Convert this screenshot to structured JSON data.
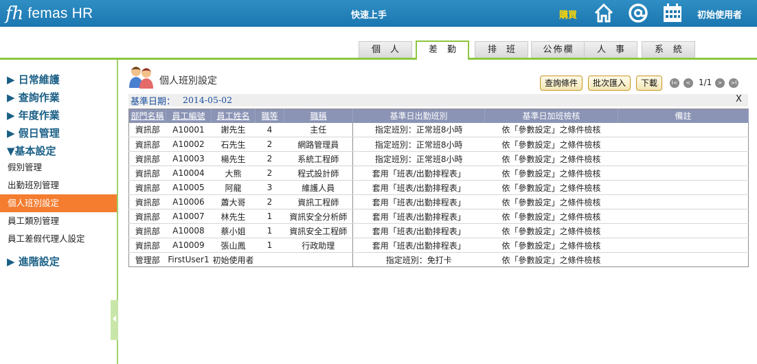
{
  "header": {
    "logo_mark": "fh",
    "logo_text": "femas HR",
    "quick_link": "快速上手",
    "buy_link": "購買",
    "user_name": "初始使用者",
    "icons": [
      "home-icon",
      "at-icon",
      "calendar-icon"
    ]
  },
  "tabs": [
    {
      "label": "個人",
      "active": false
    },
    {
      "label": "差勤",
      "active": true
    },
    {
      "label": "排班",
      "active": false
    },
    {
      "label": "公佈欄",
      "active": false
    },
    {
      "label": "人事",
      "active": false
    },
    {
      "label": "系統",
      "active": false
    }
  ],
  "sidebar": {
    "sections": [
      {
        "label": "▶ 日常維護"
      },
      {
        "label": "▶ 查詢作業"
      },
      {
        "label": "▶ 年度作業"
      },
      {
        "label": "▶ 假日管理"
      },
      {
        "label": "▼基本設定"
      },
      {
        "label": "▶ 進階設定"
      }
    ],
    "items": [
      {
        "label": "假別管理",
        "active": false
      },
      {
        "label": "出勤班別管理",
        "active": false
      },
      {
        "label": "個人班別設定",
        "active": true
      },
      {
        "label": "員工類別管理",
        "active": false
      },
      {
        "label": "員工差假代理人設定",
        "active": false
      }
    ]
  },
  "page": {
    "title": "個人班別設定",
    "buttons": {
      "query": "查詢條件",
      "batch_import": "批次匯入",
      "download": "下載"
    },
    "pager": {
      "first": "I<",
      "prev": "<",
      "text": "1/1",
      "next": ">",
      "last": ">I"
    },
    "date_label": "基準日期：",
    "date_value": "2014-05-02",
    "close": "X"
  },
  "table": {
    "columns": [
      "部門名稱",
      "員工編號",
      "員工姓名",
      "職等",
      "職稱",
      "基準日出勤班別",
      "基準日加班檢核",
      "備註"
    ],
    "rows": [
      {
        "dept": "資訊部",
        "id": "A10001",
        "name": "謝先生",
        "grade": "4",
        "title": "主任",
        "shift": "指定班別：正常班8小時",
        "shift_link": false,
        "overtime": "依「參數設定」之條件檢核",
        "note": ""
      },
      {
        "dept": "資訊部",
        "id": "A10002",
        "name": "石先生",
        "grade": "2",
        "title": "網路管理員",
        "shift": "指定班別：正常班8小時",
        "shift_link": false,
        "overtime": "依「參數設定」之條件檢核",
        "note": ""
      },
      {
        "dept": "資訊部",
        "id": "A10003",
        "name": "楊先生",
        "grade": "2",
        "title": "系統工程師",
        "shift": "指定班別：正常班8小時",
        "shift_link": false,
        "overtime": "依「參數設定」之條件檢核",
        "note": ""
      },
      {
        "dept": "資訊部",
        "id": "A10004",
        "name": "大熊",
        "grade": "2",
        "title": "程式設計師",
        "shift": "套用「班表/出勤排程表」",
        "shift_link": true,
        "overtime": "依「參數設定」之條件檢核",
        "note": ""
      },
      {
        "dept": "資訊部",
        "id": "A10005",
        "name": "阿龍",
        "grade": "3",
        "title": "維護人員",
        "shift": "套用「班表/出勤排程表」",
        "shift_link": true,
        "overtime": "依「參數設定」之條件檢核",
        "note": ""
      },
      {
        "dept": "資訊部",
        "id": "A10006",
        "name": "蕭大哥",
        "grade": "2",
        "title": "資訊工程師",
        "shift": "套用「班表/出勤排程表」",
        "shift_link": true,
        "overtime": "依「參數設定」之條件檢核",
        "note": ""
      },
      {
        "dept": "資訊部",
        "id": "A10007",
        "name": "林先生",
        "grade": "1",
        "title": "資訊安全分析師",
        "shift": "套用「班表/出勤排程表」",
        "shift_link": true,
        "overtime": "依「參數設定」之條件檢核",
        "note": ""
      },
      {
        "dept": "資訊部",
        "id": "A10008",
        "name": "蔡小姐",
        "grade": "1",
        "title": "資訊安全工程師",
        "shift": "套用「班表/出勤排程表」",
        "shift_link": true,
        "overtime": "依「參數設定」之條件檢核",
        "note": ""
      },
      {
        "dept": "資訊部",
        "id": "A10009",
        "name": "張山鳳",
        "grade": "1",
        "title": "行政助理",
        "shift": "套用「班表/出勤排程表」",
        "shift_link": true,
        "overtime": "依「參數設定」之條件檢核",
        "note": ""
      },
      {
        "dept": "管理部",
        "id": "FirstUser1",
        "name": "初始使用者",
        "grade": "",
        "title": "",
        "shift": "指定班別：免打卡",
        "shift_link": false,
        "overtime": "依「參數設定」之條件檢核",
        "note": ""
      }
    ]
  },
  "colors": {
    "header_bg": "#1b77b0",
    "accent_green": "#8dc63f",
    "active_orange": "#f47d30",
    "link_blue": "#1c5fb3",
    "table_header": "#8b94b5",
    "buy_yellow": "#ffd400"
  }
}
